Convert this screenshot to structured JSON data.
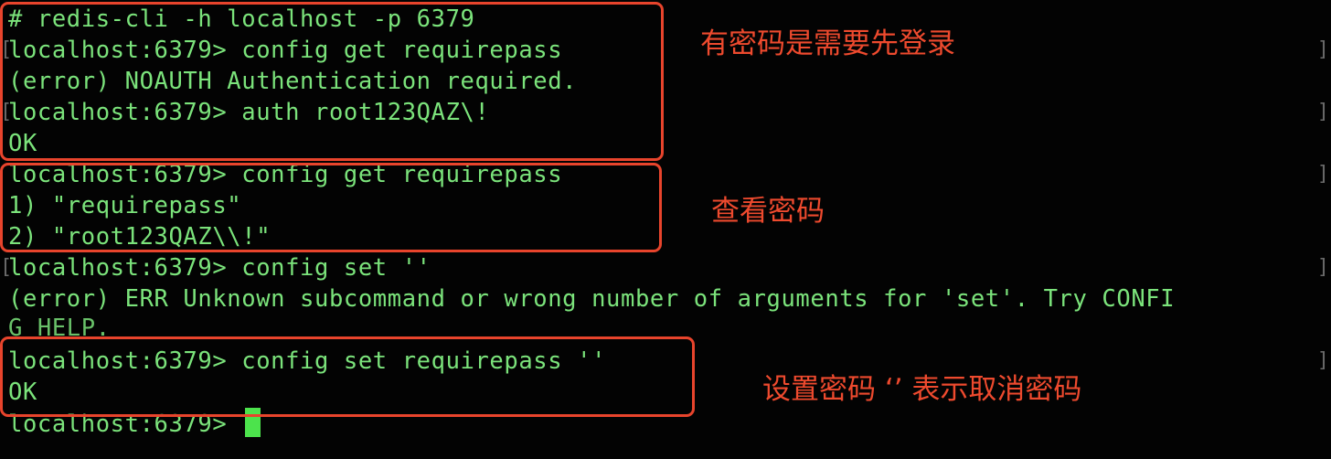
{
  "terminal": {
    "lines": [
      "# redis-cli -h localhost -p 6379",
      "localhost:6379> config get requirepass",
      "(error) NOAUTH Authentication required.",
      "localhost:6379> auth root123QAZ\\!",
      "OK",
      "localhost:6379> config get requirepass",
      "1) \"requirepass\"",
      "2) \"root123QAZ\\\\!\"",
      "localhost:6379> config set ''",
      "(error) ERR Unknown subcommand or wrong number of arguments for 'set'. Try CONFI",
      "G HELP.",
      "localhost:6379> config set requirepass ''",
      "OK",
      "localhost:6379> "
    ],
    "edge_left": "[",
    "edge_right": "]"
  },
  "annotations": {
    "login_note": "有密码是需要先登录",
    "view_note": "查看密码",
    "clear_note": "设置密码 ‘’ 表示取消密码"
  },
  "colors": {
    "text": "#7BE37B",
    "cursor": "#4CE34C",
    "annotation": "#EE4A2E",
    "background": "#030303"
  }
}
